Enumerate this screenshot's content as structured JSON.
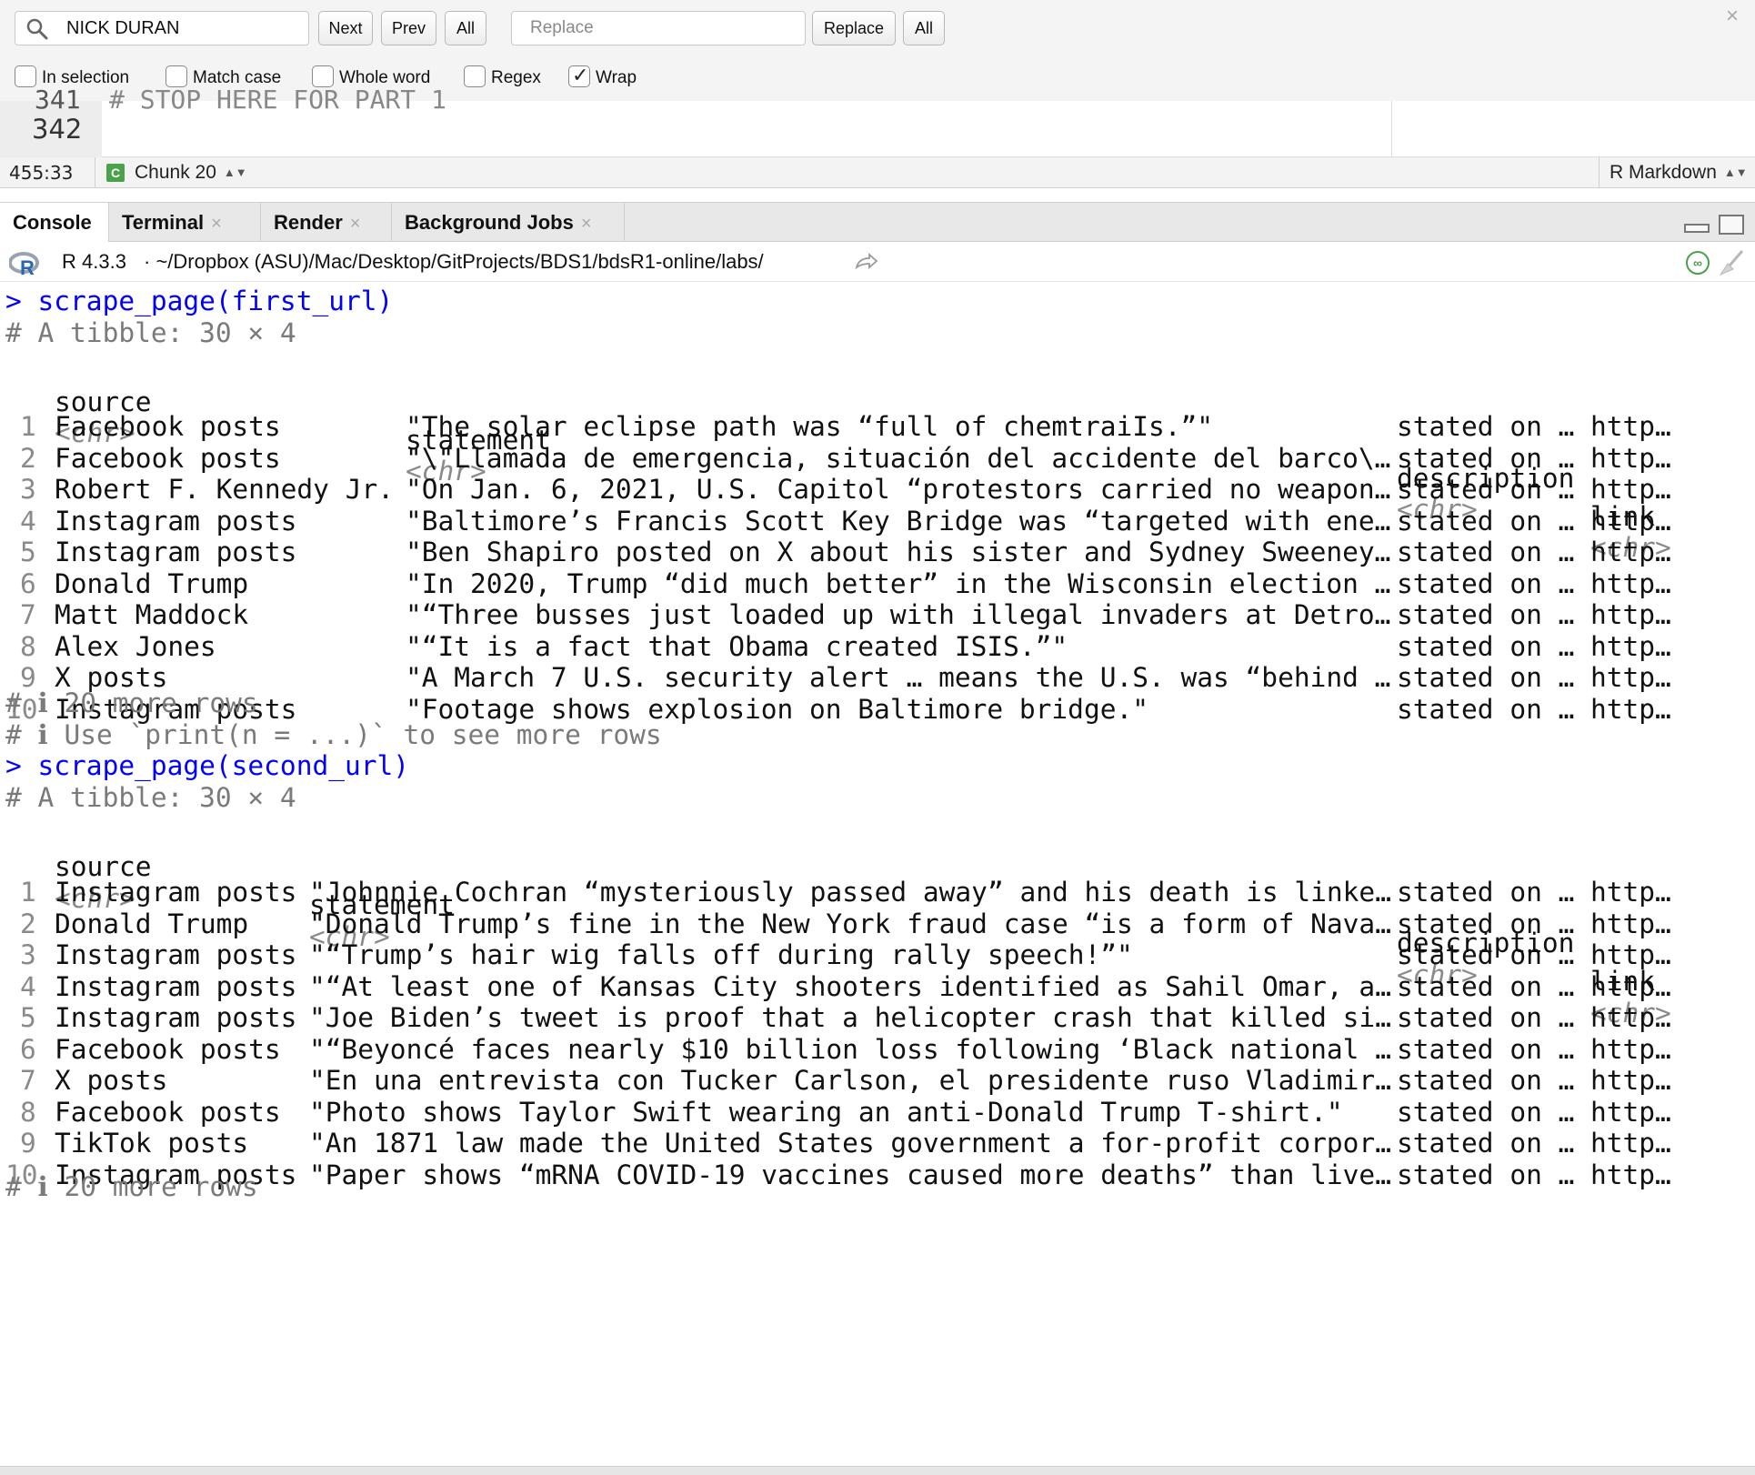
{
  "find_bar": {
    "search_value": "NICK DURAN",
    "next_label": "Next",
    "prev_label": "Prev",
    "all_label": "All",
    "replace_placeholder": "Replace",
    "replace_label": "Replace",
    "replace_all_label": "All",
    "options": [
      {
        "label": "In selection",
        "checked": false
      },
      {
        "label": "Match case",
        "checked": false
      },
      {
        "label": "Whole word",
        "checked": false
      },
      {
        "label": "Regex",
        "checked": false
      },
      {
        "label": "Wrap",
        "checked": true
      }
    ]
  },
  "editor": {
    "cut_line_number": "341",
    "cut_code": "# STOP HERE FOR PART 1",
    "line_number": "342"
  },
  "status_bar": {
    "cursor_position": "455:33",
    "chunk_label": "Chunk 20",
    "mode": "R Markdown"
  },
  "tabs": [
    {
      "label": "Console",
      "active": true,
      "closable": false
    },
    {
      "label": "Terminal",
      "active": false,
      "closable": true
    },
    {
      "label": "Render",
      "active": false,
      "closable": true
    },
    {
      "label": "Background Jobs",
      "active": false,
      "closable": true
    }
  ],
  "console_header": {
    "r_version": "R 4.3.3",
    "separator": "·",
    "path": "~/Dropbox (ASU)/Mac/Desktop/GitProjects/BDS1/bdsR1-online/labs/"
  },
  "console": {
    "blocks": [
      {
        "command": "> scrape_page(first_url)",
        "tibble_line": "# A tibble: 30 × 4",
        "headers": [
          "source",
          "statement",
          "description",
          "link"
        ],
        "types": [
          "<chr>",
          "<chr>",
          "<chr>",
          "<chr>"
        ],
        "rows": [
          {
            "n": "1",
            "source": "Facebook posts",
            "statement": "\"The solar eclipse path was “full of chemtraiIs.”\"",
            "description": "stated on …",
            "link": "http…"
          },
          {
            "n": "2",
            "source": "Facebook posts",
            "statement": "\"\\\"Llamada de emergencia, situación del accidente del barco\\…",
            "description": "stated on …",
            "link": "http…"
          },
          {
            "n": "3",
            "source": "Robert F. Kennedy Jr.",
            "statement": "\"On Jan. 6, 2021, U.S. Capitol “protestors carried no weapon…",
            "description": "stated on …",
            "link": "http…"
          },
          {
            "n": "4",
            "source": "Instagram posts",
            "statement": "\"Baltimore’s Francis Scott Key Bridge was “targeted with ene…",
            "description": "stated on …",
            "link": "http…"
          },
          {
            "n": "5",
            "source": "Instagram posts",
            "statement": "\"Ben Shapiro posted on X about his sister and Sydney Sweeney…",
            "description": "stated on …",
            "link": "http…"
          },
          {
            "n": "6",
            "source": "Donald Trump",
            "statement": "\"In 2020, Trump “did much better” in the Wisconsin election …",
            "description": "stated on …",
            "link": "http…"
          },
          {
            "n": "7",
            "source": "Matt Maddock",
            "statement": "\"“Three busses just loaded up with illegal invaders at Detro…",
            "description": "stated on …",
            "link": "http…"
          },
          {
            "n": "8",
            "source": "Alex Jones",
            "statement": "\"“It is a fact that Obama created ISIS.”\"",
            "description": "stated on …",
            "link": "http…"
          },
          {
            "n": "9",
            "source": "X posts",
            "statement": "\"A March 7 U.S. security alert … means the U.S. was “behind …",
            "description": "stated on …",
            "link": "http…"
          },
          {
            "n": "10",
            "source": "Instagram posts",
            "statement": "\"Footage shows explosion on Baltimore bridge.\"",
            "description": "stated on …",
            "link": "http…"
          }
        ],
        "more_rows": "# ℹ 20 more rows",
        "hint": "# ℹ Use `print(n = ...)` to see more rows"
      },
      {
        "command": "> scrape_page(second_url)",
        "tibble_line": "# A tibble: 30 × 4",
        "headers": [
          "source",
          "statement",
          "description",
          "link"
        ],
        "types": [
          "<chr>",
          "<chr>",
          "<chr>",
          "<chr>"
        ],
        "rows": [
          {
            "n": "1",
            "source": "Instagram posts",
            "statement": "\"Johnnie Cochran “mysteriously passed away” and his death is linke…",
            "description": "stated on …",
            "link": "http…"
          },
          {
            "n": "2",
            "source": "Donald Trump",
            "statement": "\"Donald Trump’s fine in the New York fraud case “is a form of Nava…",
            "description": "stated on …",
            "link": "http…"
          },
          {
            "n": "3",
            "source": "Instagram posts",
            "statement": "\"“Trump’s hair wig falls off during rally speech!”\"",
            "description": "stated on …",
            "link": "http…"
          },
          {
            "n": "4",
            "source": "Instagram posts",
            "statement": "\"“At least one of Kansas City shooters identified as Sahil Omar, a…",
            "description": "stated on …",
            "link": "http…"
          },
          {
            "n": "5",
            "source": "Instagram posts",
            "statement": "\"Joe Biden’s tweet is proof that a helicopter crash that killed si…",
            "description": "stated on …",
            "link": "http…"
          },
          {
            "n": "6",
            "source": "Facebook posts",
            "statement": "\"“Beyoncé faces nearly $10 billion loss following ‘Black national …",
            "description": "stated on …",
            "link": "http…"
          },
          {
            "n": "7",
            "source": "X posts",
            "statement": "\"En una entrevista con Tucker Carlson, el presidente ruso Vladimir…",
            "description": "stated on …",
            "link": "http…"
          },
          {
            "n": "8",
            "source": "Facebook posts",
            "statement": "\"Photo shows Taylor Swift wearing an anti-Donald Trump T-shirt.\"",
            "description": "stated on …",
            "link": "http…"
          },
          {
            "n": "9",
            "source": "TikTok posts",
            "statement": "\"An 1871 law made the United States government a for-profit corpor…",
            "description": "stated on …",
            "link": "http…"
          },
          {
            "n": "10",
            "source": "Instagram posts",
            "statement": "\"Paper shows “mRNA COVID-19 vaccines caused more deaths” than live…",
            "description": "stated on …",
            "link": "http…"
          }
        ],
        "more_rows": "# ℹ 20 more rows"
      }
    ]
  }
}
